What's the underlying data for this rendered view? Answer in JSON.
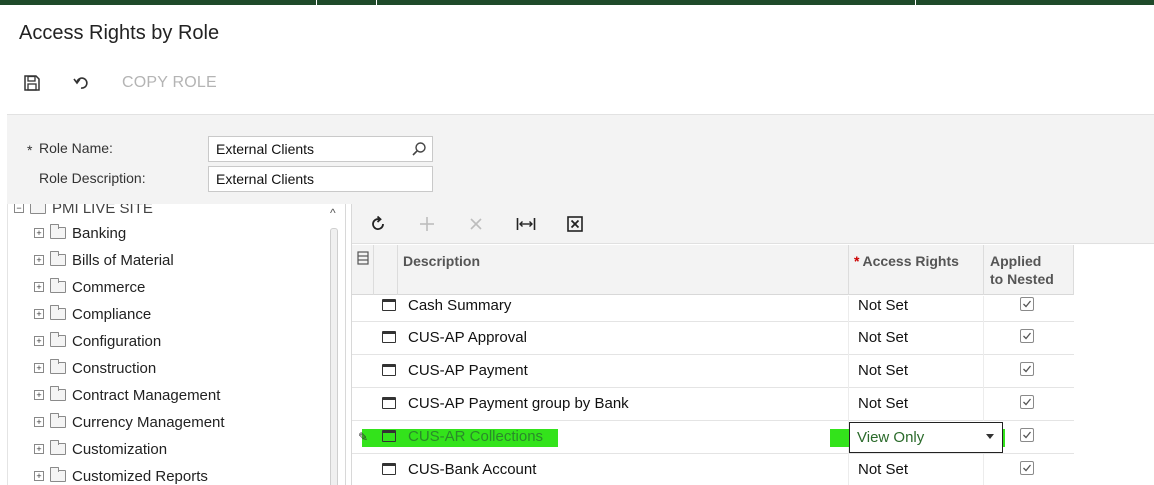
{
  "app": {
    "page_title": "Access Rights by Role"
  },
  "toolbar": {
    "save_icon": "save-icon",
    "undo_icon": "undo-icon",
    "copy_role_label": "COPY ROLE"
  },
  "form": {
    "role_name_label": "Role Name:",
    "role_name_required": "*",
    "role_name_value": "External Clients",
    "role_description_label": "Role Description:",
    "role_description_value": "External Clients"
  },
  "tree": {
    "root_label": "PMI LIVE SITE",
    "items": [
      {
        "label": "Banking"
      },
      {
        "label": "Bills of Material"
      },
      {
        "label": "Commerce"
      },
      {
        "label": "Compliance"
      },
      {
        "label": "Configuration"
      },
      {
        "label": "Construction"
      },
      {
        "label": "Contract Management"
      },
      {
        "label": "Currency Management"
      },
      {
        "label": "Customization"
      },
      {
        "label": "Customized Reports"
      }
    ]
  },
  "grid": {
    "toolbar_icons": [
      "refresh-icon",
      "add-icon",
      "delete-icon",
      "fit-columns-icon",
      "export-excel-icon"
    ],
    "columns": {
      "description": "Description",
      "access_rights": "Access Rights",
      "access_rights_required": "*",
      "applied_line1": "Applied",
      "applied_line2": "to Nested"
    },
    "rows": [
      {
        "description": "Cash Summary",
        "access": "Not Set",
        "applied": true
      },
      {
        "description": "CUS-AP Approval",
        "access": "Not Set",
        "applied": true
      },
      {
        "description": "CUS-AP Payment",
        "access": "Not Set",
        "applied": true
      },
      {
        "description": "CUS-AP Payment group by Bank",
        "access": "Not Set",
        "applied": true
      },
      {
        "description": "CUS-AR Collections",
        "access": "View Only",
        "applied": true,
        "active": true
      },
      {
        "description": "CUS-Bank Account",
        "access": "Not Set",
        "applied": true
      }
    ]
  },
  "colors": {
    "top_bar": "#1f4a2a",
    "highlight": "#33e31b",
    "disabled_text": "#b4b4b4"
  }
}
